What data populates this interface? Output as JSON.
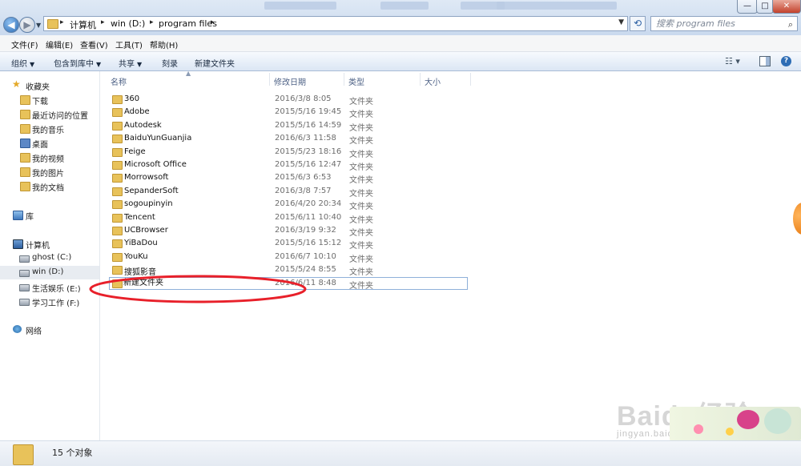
{
  "address": {
    "crumbs": [
      "计算机",
      "win (D:)",
      "program files"
    ],
    "search_placeholder": "搜索 program files"
  },
  "window": {
    "minimize": "—",
    "maximize": "□",
    "close": "✕"
  },
  "menu": [
    "文件(F)",
    "编辑(E)",
    "查看(V)",
    "工具(T)",
    "帮助(H)"
  ],
  "commands": [
    "组织",
    "包含到库中",
    "共享",
    "刻录",
    "新建文件夹"
  ],
  "nav": {
    "favorites_title": "收藏夹",
    "favorites": [
      "下载",
      "最近访问的位置",
      "我的音乐",
      "桌面",
      "我的视频",
      "我的图片",
      "我的文档"
    ],
    "libraries": "库",
    "computer": "计算机",
    "drives": [
      "ghost (C:)",
      "win (D:)",
      "生活娱乐 (E:)",
      "学习工作 (F:)"
    ],
    "network": "网络"
  },
  "columns": [
    "名称",
    "修改日期",
    "类型",
    "大小"
  ],
  "files": [
    {
      "name": "360",
      "date": "2016/3/8 8:05",
      "type": "文件夹"
    },
    {
      "name": "Adobe",
      "date": "2015/5/16 19:45",
      "type": "文件夹"
    },
    {
      "name": "Autodesk",
      "date": "2015/5/16 14:59",
      "type": "文件夹"
    },
    {
      "name": "BaiduYunGuanjia",
      "date": "2016/6/3 11:58",
      "type": "文件夹"
    },
    {
      "name": "Feige",
      "date": "2015/5/23 18:16",
      "type": "文件夹"
    },
    {
      "name": "Microsoft Office",
      "date": "2015/5/16 12:47",
      "type": "文件夹"
    },
    {
      "name": "Morrowsoft",
      "date": "2015/6/3 6:53",
      "type": "文件夹"
    },
    {
      "name": "SepanderSoft",
      "date": "2016/3/8 7:57",
      "type": "文件夹"
    },
    {
      "name": "sogoupinyin",
      "date": "2016/4/20 20:34",
      "type": "文件夹"
    },
    {
      "name": "Tencent",
      "date": "2015/6/11 10:40",
      "type": "文件夹"
    },
    {
      "name": "UCBrowser",
      "date": "2016/3/19 9:32",
      "type": "文件夹"
    },
    {
      "name": "YiBaDou",
      "date": "2015/5/16 15:12",
      "type": "文件夹"
    },
    {
      "name": "YouKu",
      "date": "2016/6/7 10:10",
      "type": "文件夹"
    },
    {
      "name": "搜狐影音",
      "date": "2015/5/24 8:55",
      "type": "文件夹"
    },
    {
      "name": "新建文件夹",
      "date": "2016/6/11 8:48",
      "type": "文件夹"
    }
  ],
  "status": {
    "count": "15 个对象"
  },
  "watermark": {
    "logo": "Baidu经验",
    "url": "jingyan.baidu.com"
  },
  "colors": {
    "annotation": "#e8202a",
    "folder": "#e8c25a",
    "header_text": "#4d6185"
  }
}
